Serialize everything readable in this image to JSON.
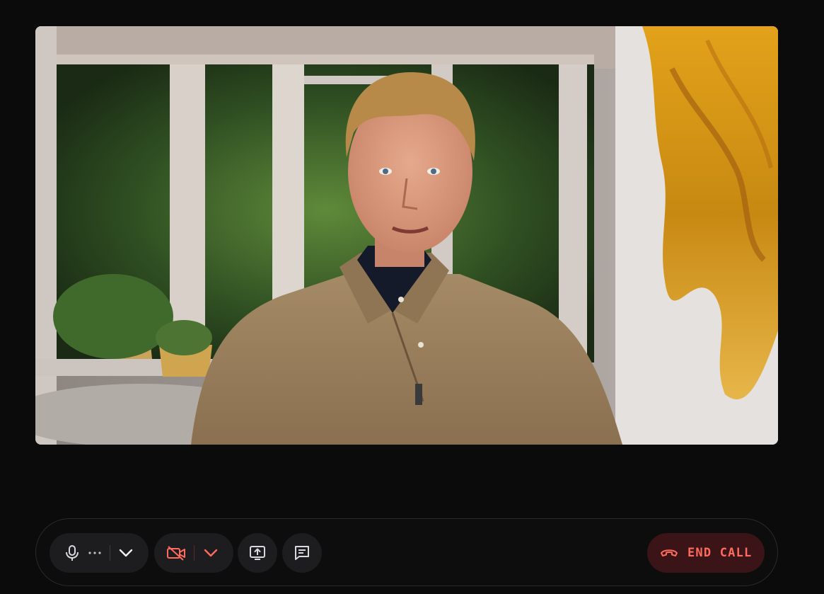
{
  "call": {
    "participant_video": "participant-video",
    "controls": {
      "mic": {
        "icon": "microphone-icon",
        "level_icon": "audio-level-dots-icon",
        "menu_icon": "chevron-down-icon"
      },
      "camera": {
        "icon": "camera-off-icon",
        "menu_icon": "chevron-down-icon",
        "state": "off"
      },
      "share": {
        "icon": "screen-share-icon"
      },
      "chat": {
        "icon": "chat-icon"
      },
      "end_call": {
        "icon": "phone-hangup-icon",
        "label": "END CALL"
      }
    }
  },
  "colors": {
    "background": "#0b0b0c",
    "control_pill": "#1d1d1f",
    "danger": "#ff6b5e",
    "danger_bg": "#3a1416"
  }
}
